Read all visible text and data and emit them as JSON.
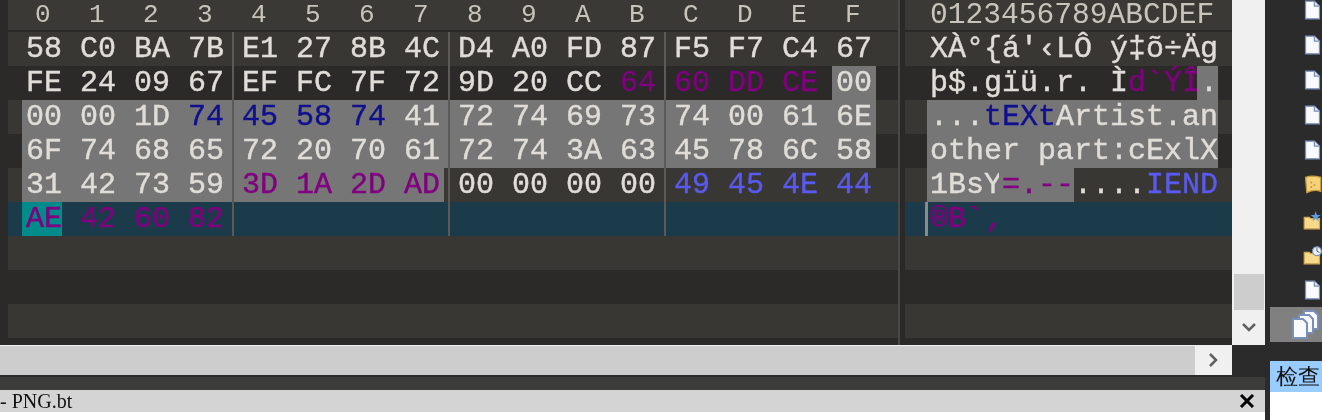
{
  "header": {
    "hex_columns": [
      "0",
      "1",
      "2",
      "3",
      "4",
      "5",
      "6",
      "7",
      "8",
      "9",
      "A",
      "B",
      "C",
      "D",
      "E",
      "F"
    ],
    "ascii_columns": "0123456789ABCDEF"
  },
  "rows": [
    {
      "current": false,
      "bytes": [
        {
          "text": "58",
          "color": "#e0ddd8",
          "selected": false,
          "cursor": false
        },
        {
          "text": "C0",
          "color": "#e0ddd8",
          "selected": false,
          "cursor": false
        },
        {
          "text": "BA",
          "color": "#e0ddd8",
          "selected": false,
          "cursor": false
        },
        {
          "text": "7B",
          "color": "#e0ddd8",
          "selected": false,
          "cursor": false
        },
        {
          "text": "E1",
          "color": "#e0ddd8",
          "selected": false,
          "cursor": false
        },
        {
          "text": "27",
          "color": "#e0ddd8",
          "selected": false,
          "cursor": false
        },
        {
          "text": "8B",
          "color": "#e0ddd8",
          "selected": false,
          "cursor": false
        },
        {
          "text": "4C",
          "color": "#e0ddd8",
          "selected": false,
          "cursor": false
        },
        {
          "text": "D4",
          "color": "#e0ddd8",
          "selected": false,
          "cursor": false
        },
        {
          "text": "A0",
          "color": "#e0ddd8",
          "selected": false,
          "cursor": false
        },
        {
          "text": "FD",
          "color": "#e0ddd8",
          "selected": false,
          "cursor": false
        },
        {
          "text": "87",
          "color": "#e0ddd8",
          "selected": false,
          "cursor": false
        },
        {
          "text": "F5",
          "color": "#e0ddd8",
          "selected": false,
          "cursor": false
        },
        {
          "text": "F7",
          "color": "#e0ddd8",
          "selected": false,
          "cursor": false
        },
        {
          "text": "C4",
          "color": "#e0ddd8",
          "selected": false,
          "cursor": false
        },
        {
          "text": "67",
          "color": "#e0ddd8",
          "selected": false,
          "cursor": false
        }
      ],
      "ascii": [
        {
          "text": "XÀ°{á'‹LÔ ý‡õ÷Äg",
          "color": "#e0ddd8",
          "selected": false,
          "cursor": false
        }
      ]
    },
    {
      "current": false,
      "bytes": [
        {
          "text": "FE",
          "color": "#e0ddd8",
          "selected": false,
          "cursor": false
        },
        {
          "text": "24",
          "color": "#e0ddd8",
          "selected": false,
          "cursor": false
        },
        {
          "text": "09",
          "color": "#e0ddd8",
          "selected": false,
          "cursor": false
        },
        {
          "text": "67",
          "color": "#e0ddd8",
          "selected": false,
          "cursor": false
        },
        {
          "text": "EF",
          "color": "#e0ddd8",
          "selected": false,
          "cursor": false
        },
        {
          "text": "FC",
          "color": "#e0ddd8",
          "selected": false,
          "cursor": false
        },
        {
          "text": "7F",
          "color": "#e0ddd8",
          "selected": false,
          "cursor": false
        },
        {
          "text": "72",
          "color": "#e0ddd8",
          "selected": false,
          "cursor": false
        },
        {
          "text": "9D",
          "color": "#e0ddd8",
          "selected": false,
          "cursor": false
        },
        {
          "text": "20",
          "color": "#e0ddd8",
          "selected": false,
          "cursor": false
        },
        {
          "text": "CC",
          "color": "#e0ddd8",
          "selected": false,
          "cursor": false
        },
        {
          "text": "64",
          "color": "#800080",
          "selected": false,
          "cursor": false
        },
        {
          "text": "60",
          "color": "#800080",
          "selected": false,
          "cursor": false
        },
        {
          "text": "DD",
          "color": "#800080",
          "selected": false,
          "cursor": false
        },
        {
          "text": "CE",
          "color": "#800080",
          "selected": false,
          "cursor": false
        },
        {
          "text": "00",
          "color": "#e0ddd8",
          "selected": true,
          "cursor": false
        }
      ],
      "ascii": [
        {
          "text": "þ$.gïü.r. Ì",
          "color": "#e0ddd8",
          "selected": false,
          "cursor": false
        },
        {
          "text": "d`ÝÎ",
          "color": "#800080",
          "selected": false,
          "cursor": false
        },
        {
          "text": ".",
          "color": "#e0ddd8",
          "selected": true,
          "cursor": false
        }
      ]
    },
    {
      "current": false,
      "bytes": [
        {
          "text": "00",
          "color": "#e0ddd8",
          "selected": true,
          "cursor": false
        },
        {
          "text": "00",
          "color": "#e0ddd8",
          "selected": true,
          "cursor": false
        },
        {
          "text": "1D",
          "color": "#e0ddd8",
          "selected": true,
          "cursor": false
        },
        {
          "text": "74",
          "color": "#10108f",
          "selected": true,
          "cursor": false
        },
        {
          "text": "45",
          "color": "#10108f",
          "selected": true,
          "cursor": false
        },
        {
          "text": "58",
          "color": "#10108f",
          "selected": true,
          "cursor": false
        },
        {
          "text": "74",
          "color": "#10108f",
          "selected": true,
          "cursor": false
        },
        {
          "text": "41",
          "color": "#e0ddd8",
          "selected": true,
          "cursor": false
        },
        {
          "text": "72",
          "color": "#e0ddd8",
          "selected": true,
          "cursor": false
        },
        {
          "text": "74",
          "color": "#e0ddd8",
          "selected": true,
          "cursor": false
        },
        {
          "text": "69",
          "color": "#e0ddd8",
          "selected": true,
          "cursor": false
        },
        {
          "text": "73",
          "color": "#e0ddd8",
          "selected": true,
          "cursor": false
        },
        {
          "text": "74",
          "color": "#e0ddd8",
          "selected": true,
          "cursor": false
        },
        {
          "text": "00",
          "color": "#e0ddd8",
          "selected": true,
          "cursor": false
        },
        {
          "text": "61",
          "color": "#e0ddd8",
          "selected": true,
          "cursor": false
        },
        {
          "text": "6E",
          "color": "#e0ddd8",
          "selected": true,
          "cursor": false
        }
      ],
      "ascii": [
        {
          "text": "...",
          "color": "#e0ddd8",
          "selected": true,
          "cursor": false
        },
        {
          "text": "tEXt",
          "color": "#10108f",
          "selected": true,
          "cursor": false
        },
        {
          "text": "Artist.an",
          "color": "#e0ddd8",
          "selected": true,
          "cursor": false
        }
      ]
    },
    {
      "current": false,
      "bytes": [
        {
          "text": "6F",
          "color": "#e0ddd8",
          "selected": true,
          "cursor": false
        },
        {
          "text": "74",
          "color": "#e0ddd8",
          "selected": true,
          "cursor": false
        },
        {
          "text": "68",
          "color": "#e0ddd8",
          "selected": true,
          "cursor": false
        },
        {
          "text": "65",
          "color": "#e0ddd8",
          "selected": true,
          "cursor": false
        },
        {
          "text": "72",
          "color": "#e0ddd8",
          "selected": true,
          "cursor": false
        },
        {
          "text": "20",
          "color": "#e0ddd8",
          "selected": true,
          "cursor": false
        },
        {
          "text": "70",
          "color": "#e0ddd8",
          "selected": true,
          "cursor": false
        },
        {
          "text": "61",
          "color": "#e0ddd8",
          "selected": true,
          "cursor": false
        },
        {
          "text": "72",
          "color": "#e0ddd8",
          "selected": true,
          "cursor": false
        },
        {
          "text": "74",
          "color": "#e0ddd8",
          "selected": true,
          "cursor": false
        },
        {
          "text": "3A",
          "color": "#e0ddd8",
          "selected": true,
          "cursor": false
        },
        {
          "text": "63",
          "color": "#e0ddd8",
          "selected": true,
          "cursor": false
        },
        {
          "text": "45",
          "color": "#e0ddd8",
          "selected": true,
          "cursor": false
        },
        {
          "text": "78",
          "color": "#e0ddd8",
          "selected": true,
          "cursor": false
        },
        {
          "text": "6C",
          "color": "#e0ddd8",
          "selected": true,
          "cursor": false
        },
        {
          "text": "58",
          "color": "#e0ddd8",
          "selected": true,
          "cursor": false
        }
      ],
      "ascii": [
        {
          "text": "other part:cExlX",
          "color": "#e0ddd8",
          "selected": true,
          "cursor": false
        }
      ]
    },
    {
      "current": false,
      "bytes": [
        {
          "text": "31",
          "color": "#e0ddd8",
          "selected": true,
          "cursor": false
        },
        {
          "text": "42",
          "color": "#e0ddd8",
          "selected": true,
          "cursor": false
        },
        {
          "text": "73",
          "color": "#e0ddd8",
          "selected": true,
          "cursor": false
        },
        {
          "text": "59",
          "color": "#e0ddd8",
          "selected": true,
          "cursor": false
        },
        {
          "text": "3D",
          "color": "#800080",
          "selected": true,
          "cursor": false
        },
        {
          "text": "1A",
          "color": "#800080",
          "selected": true,
          "cursor": false
        },
        {
          "text": "2D",
          "color": "#800080",
          "selected": true,
          "cursor": false
        },
        {
          "text": "AD",
          "color": "#800080",
          "selected": true,
          "cursor": false
        },
        {
          "text": "00",
          "color": "#e0ddd8",
          "selected": false,
          "cursor": false
        },
        {
          "text": "00",
          "color": "#e0ddd8",
          "selected": false,
          "cursor": false
        },
        {
          "text": "00",
          "color": "#e0ddd8",
          "selected": false,
          "cursor": false
        },
        {
          "text": "00",
          "color": "#e0ddd8",
          "selected": false,
          "cursor": false
        },
        {
          "text": "49",
          "color": "#5a5af0",
          "selected": false,
          "cursor": false
        },
        {
          "text": "45",
          "color": "#5a5af0",
          "selected": false,
          "cursor": false
        },
        {
          "text": "4E",
          "color": "#5a5af0",
          "selected": false,
          "cursor": false
        },
        {
          "text": "44",
          "color": "#5a5af0",
          "selected": false,
          "cursor": false
        }
      ],
      "ascii": [
        {
          "text": "1BsY",
          "color": "#e0ddd8",
          "selected": true,
          "cursor": false
        },
        {
          "text": "=.--",
          "color": "#800080",
          "selected": true,
          "cursor": false
        },
        {
          "text": "....",
          "color": "#e0ddd8",
          "selected": false,
          "cursor": false
        },
        {
          "text": "IEND",
          "color": "#5a5af0",
          "selected": false,
          "cursor": false
        }
      ]
    },
    {
      "current": true,
      "bytes": [
        {
          "text": "AE",
          "color": "#800080",
          "selected": false,
          "cursor": true
        },
        {
          "text": "42",
          "color": "#800080",
          "selected": false,
          "cursor": false
        },
        {
          "text": "60",
          "color": "#800080",
          "selected": false,
          "cursor": false
        },
        {
          "text": "82",
          "color": "#800080",
          "selected": false,
          "cursor": false
        }
      ],
      "ascii": [
        {
          "text": "®B`‚",
          "color": "#800080",
          "selected": false,
          "cursor": true
        }
      ]
    }
  ],
  "sidebar": {
    "items": [
      {
        "kind": "document",
        "selected": false
      },
      {
        "kind": "document",
        "selected": false
      },
      {
        "kind": "document",
        "selected": false
      },
      {
        "kind": "document",
        "selected": false
      },
      {
        "kind": "document",
        "selected": false
      },
      {
        "kind": "scroll",
        "selected": false
      },
      {
        "kind": "folder-star",
        "selected": false
      },
      {
        "kind": "folder-clock",
        "selected": false
      },
      {
        "kind": "document",
        "selected": false
      },
      {
        "kind": "copies",
        "selected": true
      }
    ],
    "tab": {
      "label": "检查",
      "selected": true
    }
  },
  "bottom_panel": {
    "title": "- PNG.bt"
  }
}
